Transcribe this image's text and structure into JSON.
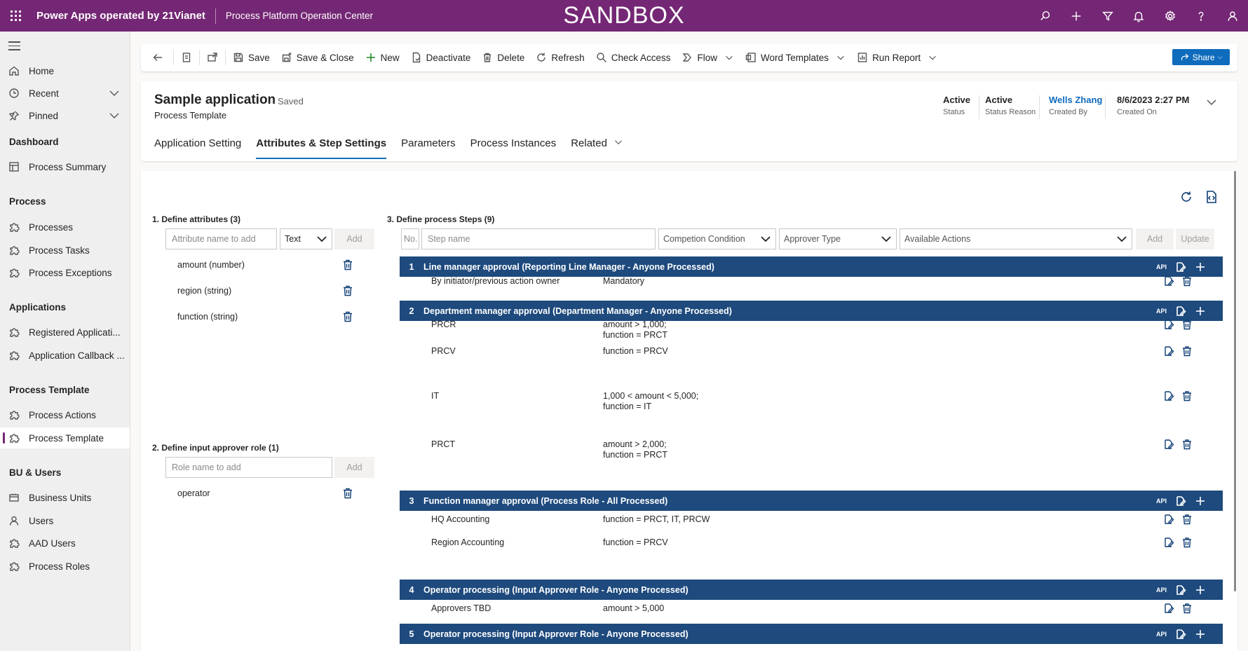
{
  "topbar": {
    "app_name": "Power Apps operated by 21Vianet",
    "environment": "Process Platform Operation Center",
    "banner": "SANDBOX",
    "icons": [
      "search-icon",
      "plus-icon",
      "filter-icon",
      "bell-icon",
      "gear-icon",
      "help-icon",
      "user-icon"
    ]
  },
  "sidebar": {
    "home": "Home",
    "recent": "Recent",
    "pinned": "Pinned",
    "groups": [
      {
        "header": "Dashboard",
        "items": [
          "Process Summary"
        ]
      },
      {
        "header": "Process",
        "items": [
          "Processes",
          "Process Tasks",
          "Process Exceptions"
        ]
      },
      {
        "header": "Applications",
        "items": [
          "Registered Applicati...",
          "Application Callback ..."
        ]
      },
      {
        "header": "Process Template",
        "items": [
          "Process Actions",
          "Process Template"
        ]
      },
      {
        "header": "BU & Users",
        "items": [
          "Business Units",
          "Users",
          "AAD Users",
          "Process Roles"
        ]
      }
    ],
    "active_item": "Process Template"
  },
  "commandbar": {
    "save": "Save",
    "save_close": "Save & Close",
    "new": "New",
    "deactivate": "Deactivate",
    "delete": "Delete",
    "refresh": "Refresh",
    "check_access": "Check Access",
    "flow": "Flow",
    "word_templates": "Word Templates",
    "run_report": "Run Report",
    "share": "Share"
  },
  "record": {
    "title": "Sample application",
    "saved": "- Saved",
    "entity": "Process Template",
    "status_value": "Active",
    "status_label": "Status",
    "status_reason_value": "Active",
    "status_reason_label": "Status Reason",
    "created_by_value": "Wells Zhang",
    "created_by_label": "Created By",
    "created_on_value": "8/6/2023 2:27 PM",
    "created_on_label": "Created On"
  },
  "tabs": [
    "Application Setting",
    "Attributes & Step Settings",
    "Parameters",
    "Process Instances",
    "Related"
  ],
  "attributes": {
    "section_title": "1. Define attributes (3)",
    "name_placeholder": "Attribute name to add",
    "type_value": "Text",
    "add_label": "Add",
    "items": [
      "amount (number)",
      "region (string)",
      "function (string)"
    ]
  },
  "roles": {
    "section_title": "2. Define input approver role (1)",
    "name_placeholder": "Role name to add",
    "add_label": "Add",
    "items": [
      "operator"
    ]
  },
  "steps": {
    "section_title": "3. Define process Steps (9)",
    "no_placeholder": "No.",
    "name_placeholder": "Step name",
    "condition_placeholder": "Competion Condition",
    "approver_placeholder": "Approver Type",
    "actions_placeholder": "Available Actions",
    "add_label": "Add",
    "update_label": "Update",
    "api_label": "API",
    "list": [
      {
        "num": "1",
        "title": "Line manager approval (Reporting Line Manager - Anyone Processed)",
        "rules": [
          {
            "name": "By initiator/previous action owner",
            "cond": "Mandatory"
          }
        ]
      },
      {
        "num": "2",
        "title": "Department manager approval (Department Manager - Anyone Processed)",
        "rules": [
          {
            "name": "PRCR",
            "cond": "amount > 1,000;\nfunction = PRCT"
          },
          {
            "name": "PRCV",
            "cond": "function = PRCV"
          },
          {
            "name": "IT",
            "cond": "1,000 < amount < 5,000;\nfunction = IT"
          },
          {
            "name": "PRCT",
            "cond": "amount > 2,000;\nfunction = PRCT"
          }
        ]
      },
      {
        "num": "3",
        "title": "Function manager approval (Process Role - All Processed)",
        "rules": [
          {
            "name": "HQ Accounting",
            "cond": "function = PRCT, IT, PRCW"
          },
          {
            "name": "Region Accounting",
            "cond": "function = PRCV"
          }
        ]
      },
      {
        "num": "4",
        "title": "Operator processing (Input Approver Role - Anyone Processed)",
        "rules": [
          {
            "name": "Approvers TBD",
            "cond": "amount > 5,000"
          }
        ]
      },
      {
        "num": "5",
        "title": "Operator processing (Input Approver Role - Anyone Processed)",
        "rules": []
      }
    ]
  }
}
